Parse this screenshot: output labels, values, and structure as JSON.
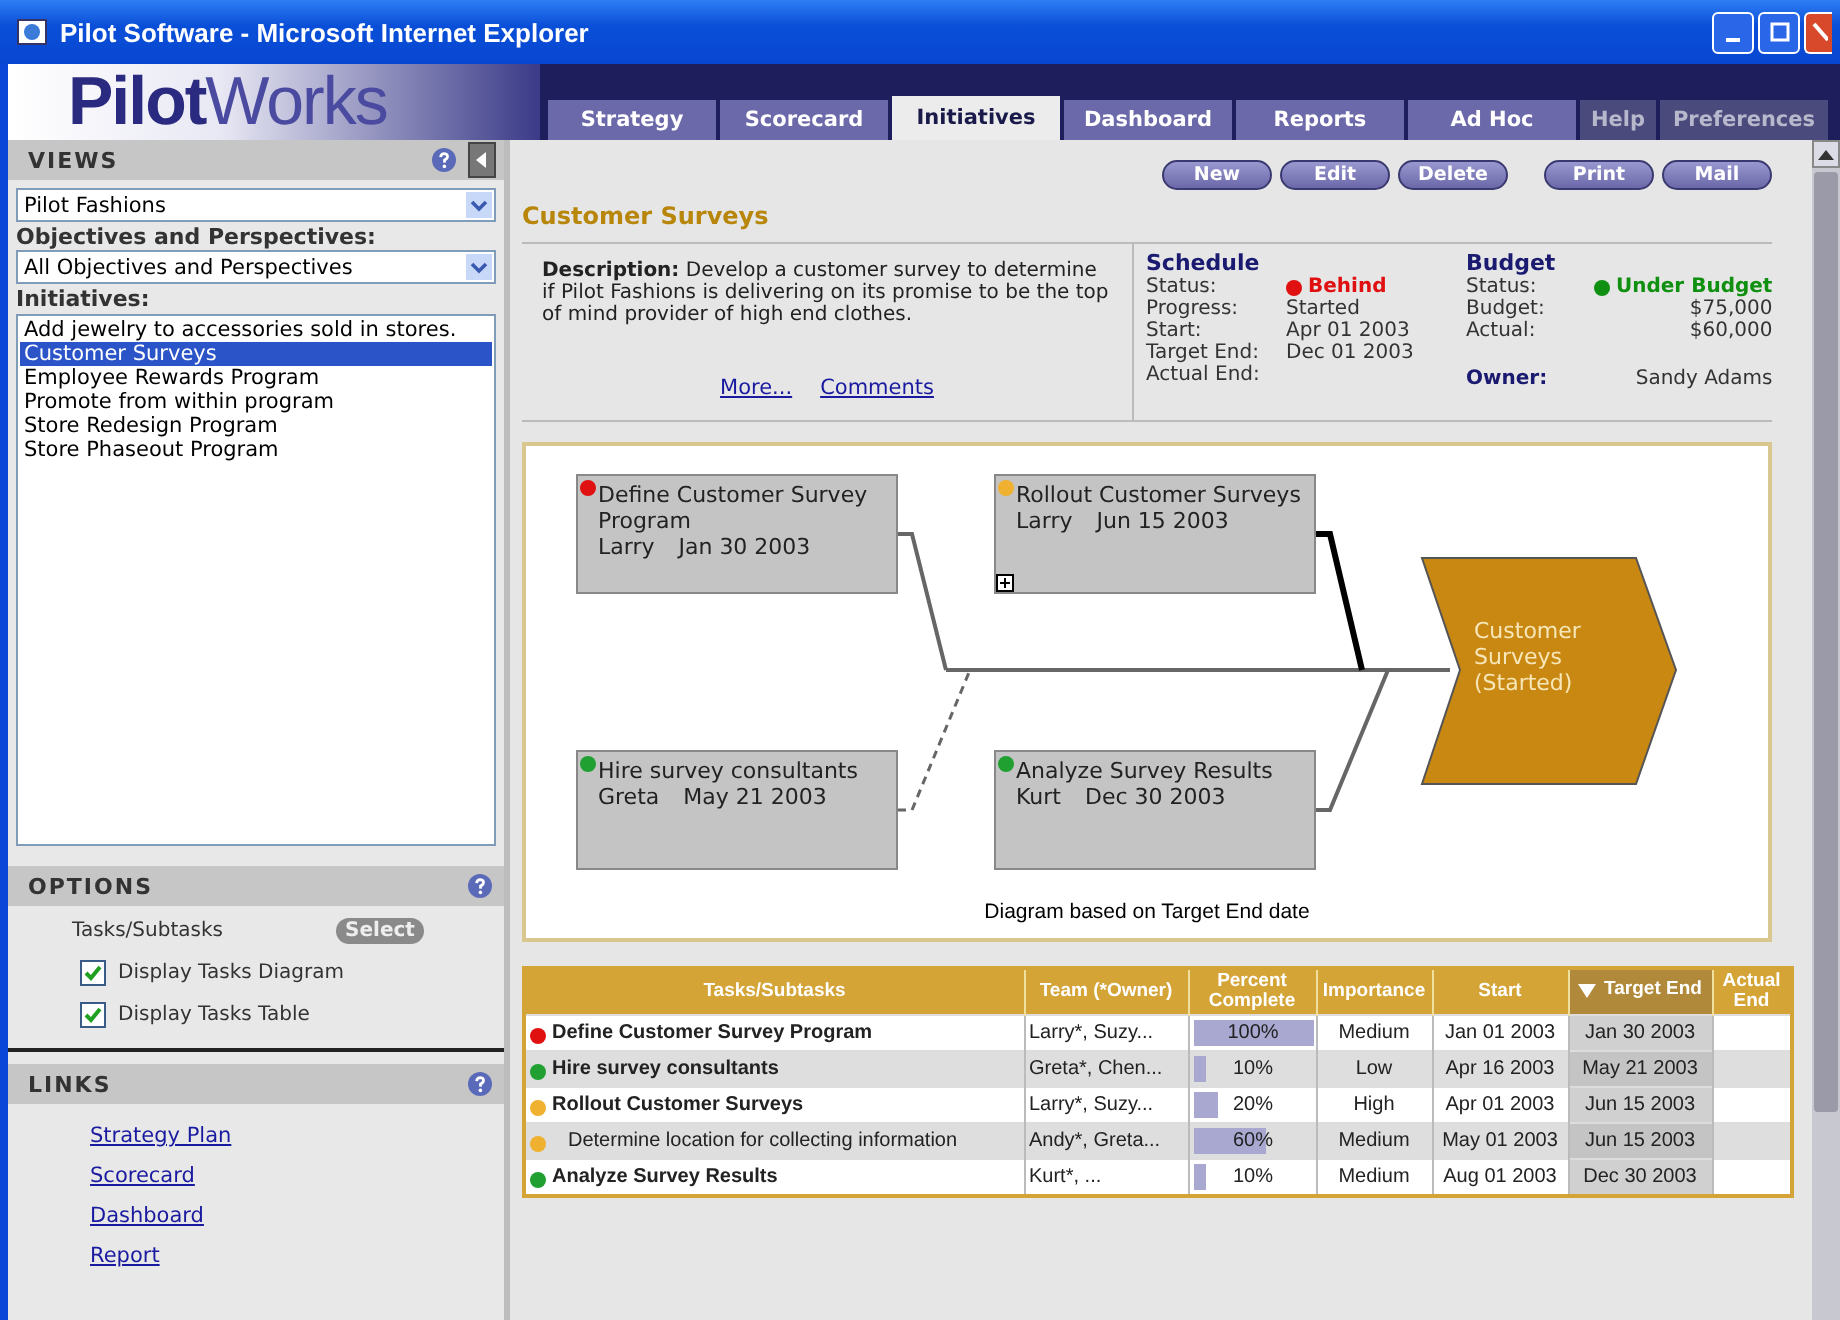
{
  "window": {
    "title": "Pilot Software - Microsoft Internet Explorer"
  },
  "logo": {
    "bold": "Pilot",
    "light": "Works"
  },
  "tabs": [
    {
      "label": "Strategy",
      "selected": false,
      "kind": "main"
    },
    {
      "label": "Scorecard",
      "selected": false,
      "kind": "main"
    },
    {
      "label": "Initiatives",
      "selected": true,
      "kind": "main"
    },
    {
      "label": "Dashboard",
      "selected": false,
      "kind": "main"
    },
    {
      "label": "Reports",
      "selected": false,
      "kind": "main"
    },
    {
      "label": "Ad Hoc",
      "selected": false,
      "kind": "main"
    },
    {
      "label": "Help",
      "selected": false,
      "kind": "utility"
    },
    {
      "label": "Preferences",
      "selected": false,
      "kind": "utility"
    }
  ],
  "sidebar": {
    "views": {
      "title": "VIEWS",
      "view_select": "Pilot Fashions",
      "objectives_label": "Objectives and Perspectives:",
      "objectives_select": "All Objectives and Perspectives",
      "initiatives_label": "Initiatives:",
      "initiatives": [
        {
          "label": "Add jewelry to accessories sold in stores.",
          "selected": false
        },
        {
          "label": "Customer Surveys",
          "selected": true
        },
        {
          "label": "Employee Rewards Program",
          "selected": false
        },
        {
          "label": "Promote from within program",
          "selected": false
        },
        {
          "label": "Store Redesign Program",
          "selected": false
        },
        {
          "label": "Store Phaseout Program",
          "selected": false
        }
      ]
    },
    "options": {
      "title": "OPTIONS",
      "tasks_label": "Tasks/Subtasks",
      "select_button": "Select",
      "checkboxes": [
        {
          "label": "Display Tasks Diagram",
          "checked": true
        },
        {
          "label": "Display Tasks Table",
          "checked": true
        }
      ]
    },
    "links": {
      "title": "LINKS",
      "items": [
        "Strategy Plan",
        "Scorecard",
        "Dashboard",
        "Report"
      ]
    }
  },
  "toolbar": {
    "buttons": [
      "New",
      "Edit",
      "Delete",
      "Print",
      "Mail"
    ]
  },
  "initiative": {
    "title": "Customer Surveys",
    "description_label": "Description:",
    "description": "Develop a customer survey to determine if Pilot Fashions is delivering on its promise to be the top of mind provider of high end clothes.",
    "links": [
      "More...",
      "Comments"
    ],
    "schedule": {
      "title": "Schedule",
      "status_label": "Status:",
      "status": "Behind",
      "kind": "bad",
      "rows": [
        {
          "label": "Progress:",
          "value": "Started"
        },
        {
          "label": "Start:",
          "value": "Apr 01 2003"
        },
        {
          "label": "Target End:",
          "value": "Dec 01 2003"
        },
        {
          "label": "Actual End:"
        }
      ]
    },
    "budget": {
      "title": "Budget",
      "status_label": "Status:",
      "status": "Under Budget",
      "kind": "good",
      "rows": [
        {
          "label": "Budget:",
          "value": "$75,000"
        },
        {
          "label": "Actual:",
          "value": "$60,000"
        }
      ],
      "owner_label": "Owner:",
      "owner": "Sandy Adams"
    }
  },
  "diagram": {
    "nodes": [
      {
        "title": "Define Customer Survey Program",
        "owner": "Larry",
        "date": "Jan 30 2003",
        "color": "#e01010",
        "kind": "solid",
        "expandable": false
      },
      {
        "title": "Rollout Customer Surveys",
        "owner": "Larry",
        "date": "Jun 15 2003",
        "color": "#f0b030",
        "kind": "bold",
        "expandable": true
      },
      {
        "title": "Hire survey consultants",
        "owner": "Greta",
        "date": "May 21 2003",
        "color": "#20a030",
        "kind": "dashed",
        "expandable": false
      },
      {
        "title": "Analyze Survey Results",
        "owner": "Kurt",
        "date": "Dec 30 2003",
        "color": "#20a030",
        "kind": "solid",
        "expandable": false
      }
    ],
    "milestone": "Customer Surveys (Started)",
    "caption": "Diagram based on Target End date"
  },
  "table": {
    "columns": [
      {
        "label": "Tasks/Subtasks",
        "sorted": false
      },
      {
        "label": "Team (*Owner)",
        "sorted": false
      },
      {
        "label": "Percent Complete",
        "sorted": false
      },
      {
        "label": "Importance",
        "sorted": false
      },
      {
        "label": "Start",
        "sorted": false
      },
      {
        "label": "Target End",
        "sorted": true
      },
      {
        "label": "Actual End",
        "sorted": false
      }
    ],
    "rows": [
      {
        "task": "Define Customer Survey Program",
        "color": "#e01010",
        "team": "Larry*, Suzy...",
        "percent": "100%",
        "level": 1.0,
        "importance": "Medium",
        "start": "Jan 01 2003",
        "target_end": "Jan 30 2003"
      },
      {
        "task": "Hire survey consultants",
        "color": "#20a030",
        "team": "Greta*, Chen...",
        "percent": "10%",
        "level": 0.1,
        "importance": "Low",
        "start": "Apr 16 2003",
        "target_end": "May 21 2003"
      },
      {
        "task": "Rollout Customer Surveys",
        "color": "#f0b030",
        "team": "Larry*, Suzy...",
        "percent": "20%",
        "level": 0.2,
        "importance": "High",
        "start": "Apr 01 2003",
        "target_end": "Jun 15 2003",
        "children": [
          {
            "task": "Determine location for collecting information",
            "color": "#f0b030",
            "team": "Andy*, Greta...",
            "percent": "60%",
            "level": 0.6,
            "importance": "Medium",
            "start": "May 01 2003",
            "target_end": "Jun 15 2003"
          }
        ]
      },
      {
        "task": "Analyze Survey Results",
        "color": "#20a030",
        "team": "Kurt*, ...",
        "percent": "10%",
        "level": 0.1,
        "importance": "Medium",
        "start": "Aug 01 2003",
        "target_end": "Dec 30 2003"
      }
    ]
  }
}
